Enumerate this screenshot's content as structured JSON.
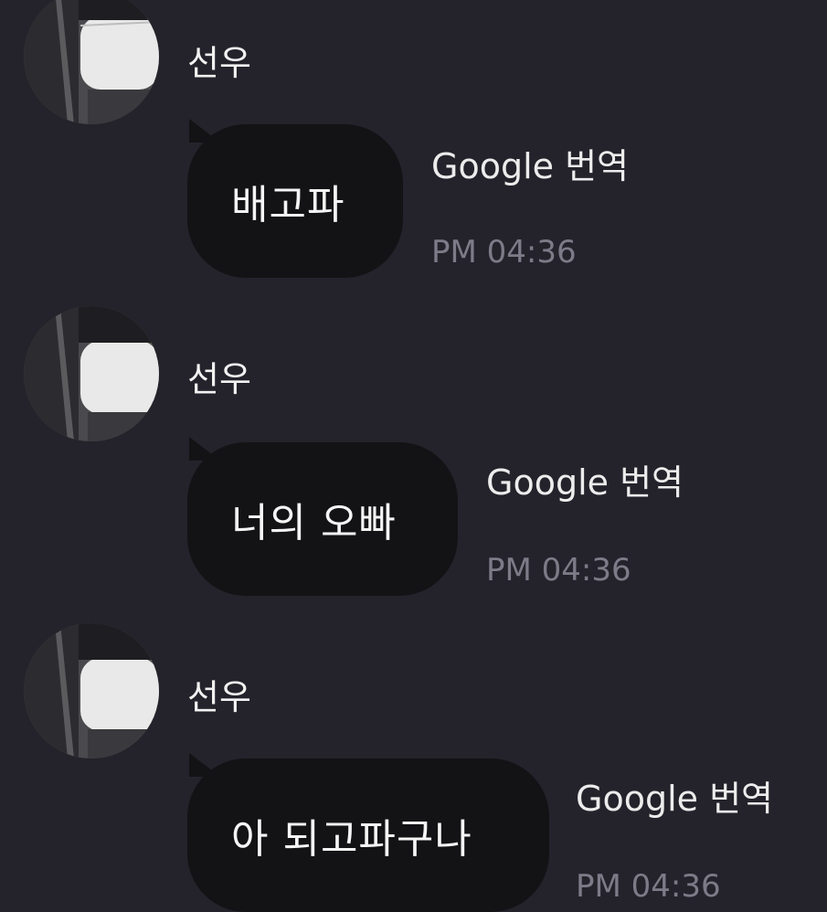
{
  "colors": {
    "background": "#24232b",
    "bubble": "#131316",
    "text": "#f5f5f5",
    "timestamp": "#7d7b88"
  },
  "messages": [
    {
      "sender": "선우",
      "avatar_icon": "profile-photo-masked",
      "text": "배고파",
      "translate_label": "Google 번역",
      "time": "PM 04:36"
    },
    {
      "sender": "선우",
      "avatar_icon": "profile-photo-masked",
      "text": "너의 오빠",
      "translate_label": "Google 번역",
      "time": "PM 04:36"
    },
    {
      "sender": "선우",
      "avatar_icon": "profile-photo-masked",
      "text": "아 되고파구나",
      "translate_label": "Google 번역",
      "time": "PM 04:36"
    }
  ]
}
